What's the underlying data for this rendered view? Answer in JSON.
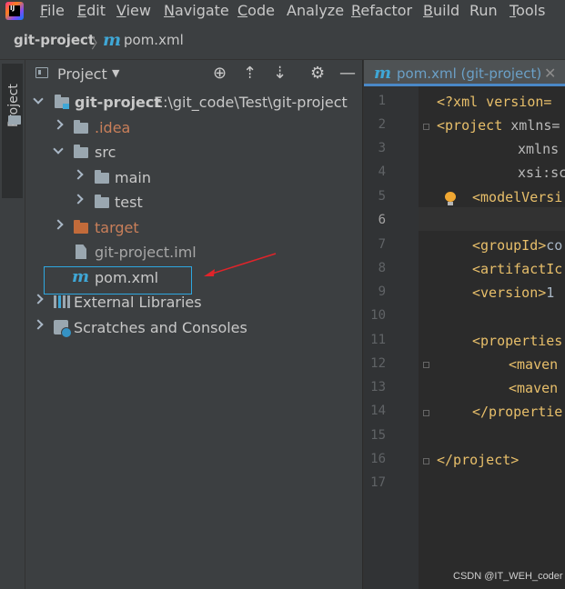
{
  "menu": {
    "app_logo_text": "IJ",
    "items": [
      {
        "label": "File",
        "mnemonic": "F",
        "rest": "ile"
      },
      {
        "label": "Edit",
        "mnemonic": "E",
        "rest": "dit"
      },
      {
        "label": "View",
        "mnemonic": "V",
        "rest": "iew"
      },
      {
        "label": "Navigate",
        "mnemonic": "N",
        "rest": "avigate"
      },
      {
        "label": "Code",
        "mnemonic": "C",
        "rest": "ode"
      },
      {
        "label": "Analyze",
        "mnemonic": "",
        "rest": "Analyze"
      },
      {
        "label": "Refactor",
        "mnemonic": "R",
        "rest": "efactor"
      },
      {
        "label": "Build",
        "mnemonic": "B",
        "rest": "uild"
      },
      {
        "label": "Run",
        "mnemonic": "",
        "rest": "Run"
      },
      {
        "label": "Tools",
        "mnemonic": "T",
        "rest": "ools"
      }
    ]
  },
  "navbar": {
    "project": "git-project",
    "separator": "〉",
    "file_icon": "m",
    "file": "pom.xml"
  },
  "side_stripe": {
    "label": "Project"
  },
  "project_panel": {
    "title": "Project",
    "caret": "▼",
    "icons": {
      "locate": "⊕",
      "expand": "⇡",
      "collapse": "⇣",
      "settings": "⚙",
      "hide": "—"
    },
    "tree": {
      "root": {
        "name": "git-project",
        "path": "E:\\git_code\\Test\\git-project"
      },
      "idea": ".idea",
      "src": "src",
      "main": "main",
      "test": "test",
      "target": "target",
      "iml": "git-project.iml",
      "pom_icon": "m",
      "pom": "pom.xml",
      "external": "External Libraries",
      "scratches": "Scratches and Consoles"
    }
  },
  "editor": {
    "tab": {
      "icon": "m",
      "label": "pom.xml (git-project)",
      "close": "✕"
    },
    "line_numbers": [
      "1",
      "2",
      "3",
      "4",
      "5",
      "6",
      "7",
      "8",
      "9",
      "10",
      "11",
      "12",
      "13",
      "14",
      "15",
      "16",
      "17"
    ],
    "lines": {
      "l1": "<?xml version=",
      "l2a": "<project ",
      "l2b": "xmlns=",
      "l3": "xmlns",
      "l4": "xsi:sc",
      "l5": "<modelVersi",
      "l7a": "<groupId>",
      "l7b": "co",
      "l8": "<artifactIc",
      "l9a": "<version>",
      "l9b": "1",
      "l11": "<properties",
      "l12": "<maven",
      "l13": "<maven",
      "l14": "</propertie",
      "l16": "</project>"
    }
  },
  "watermark": "CSDN @IT_WEH_coder",
  "colors": {
    "accent": "#2ea7e0",
    "annotation_arrow": "#e0242a",
    "xml_tag": "#e8bf6a"
  }
}
